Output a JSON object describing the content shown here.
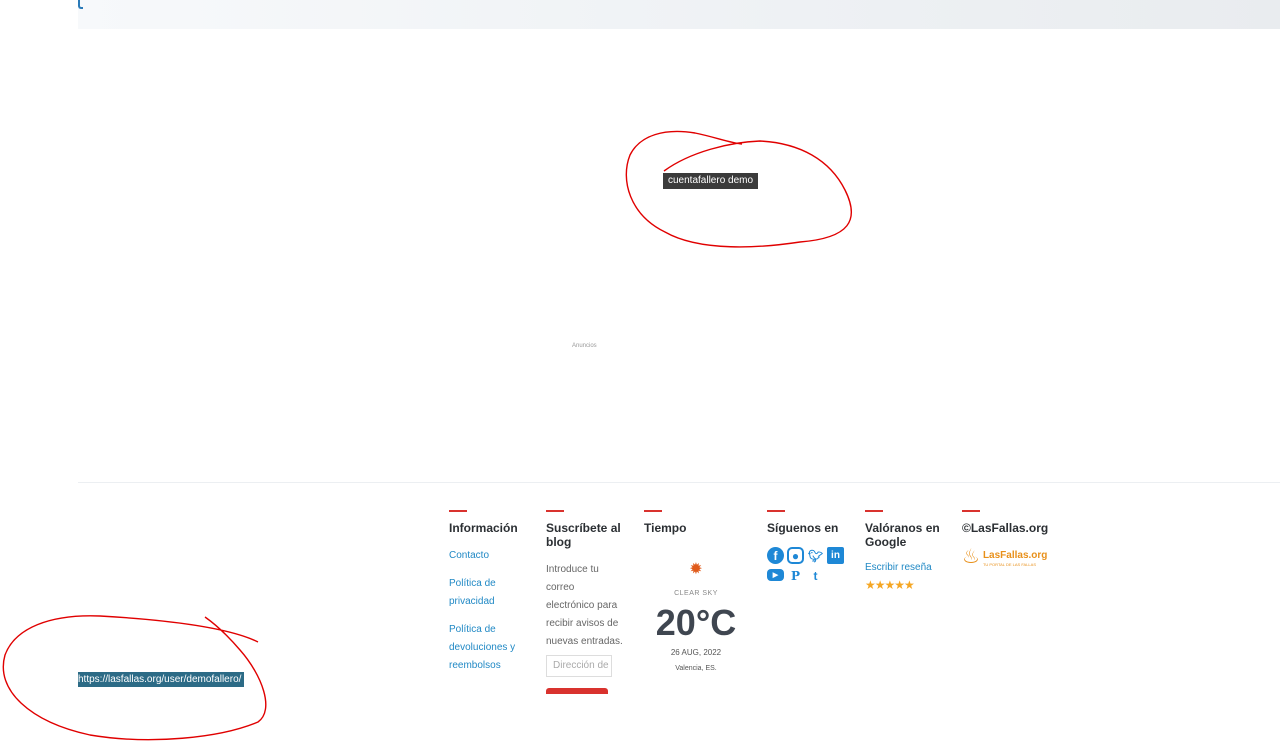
{
  "tooltip": {
    "text": "cuentafallero demo"
  },
  "ads": {
    "label": "Anuncios"
  },
  "footer": {
    "info": {
      "title": "Información",
      "links": [
        "Contacto",
        "Política de privacidad",
        "Política de devoluciones y reembolsos"
      ]
    },
    "subscribe": {
      "title": "Suscríbete al blog",
      "text": "Introduce tu correo electrónico para recibir avisos de nuevas entradas.",
      "placeholder": "Dirección de correo electrónico"
    },
    "weather": {
      "title": "Tiempo",
      "condition": "CLEAR SKY",
      "temperature": "20°C",
      "date": "26 AUG, 2022",
      "location": "Valencia, ES."
    },
    "social": {
      "title": "Síguenos en",
      "icons": [
        "facebook-icon",
        "instagram-icon",
        "twitter-icon",
        "linkedin-icon",
        "youtube-icon",
        "pinterest-icon",
        "tumblr-icon"
      ]
    },
    "review": {
      "title": "Valóranos en Google",
      "link": "Escribir reseña",
      "stars": "★★★★★"
    },
    "brand": {
      "title": "©LasFallas.org",
      "logo_name": "LasFallas.org",
      "logo_tagline": "TU PORTAL DE LAS FALLAS"
    }
  },
  "status_bar": {
    "url": "https://lasfallas.org/user/demofallero/"
  },
  "colors": {
    "accent": "#d9322e",
    "link": "#2189c5",
    "social": "#1e88d6",
    "star": "#f5a623",
    "annotation": "#e00000"
  }
}
